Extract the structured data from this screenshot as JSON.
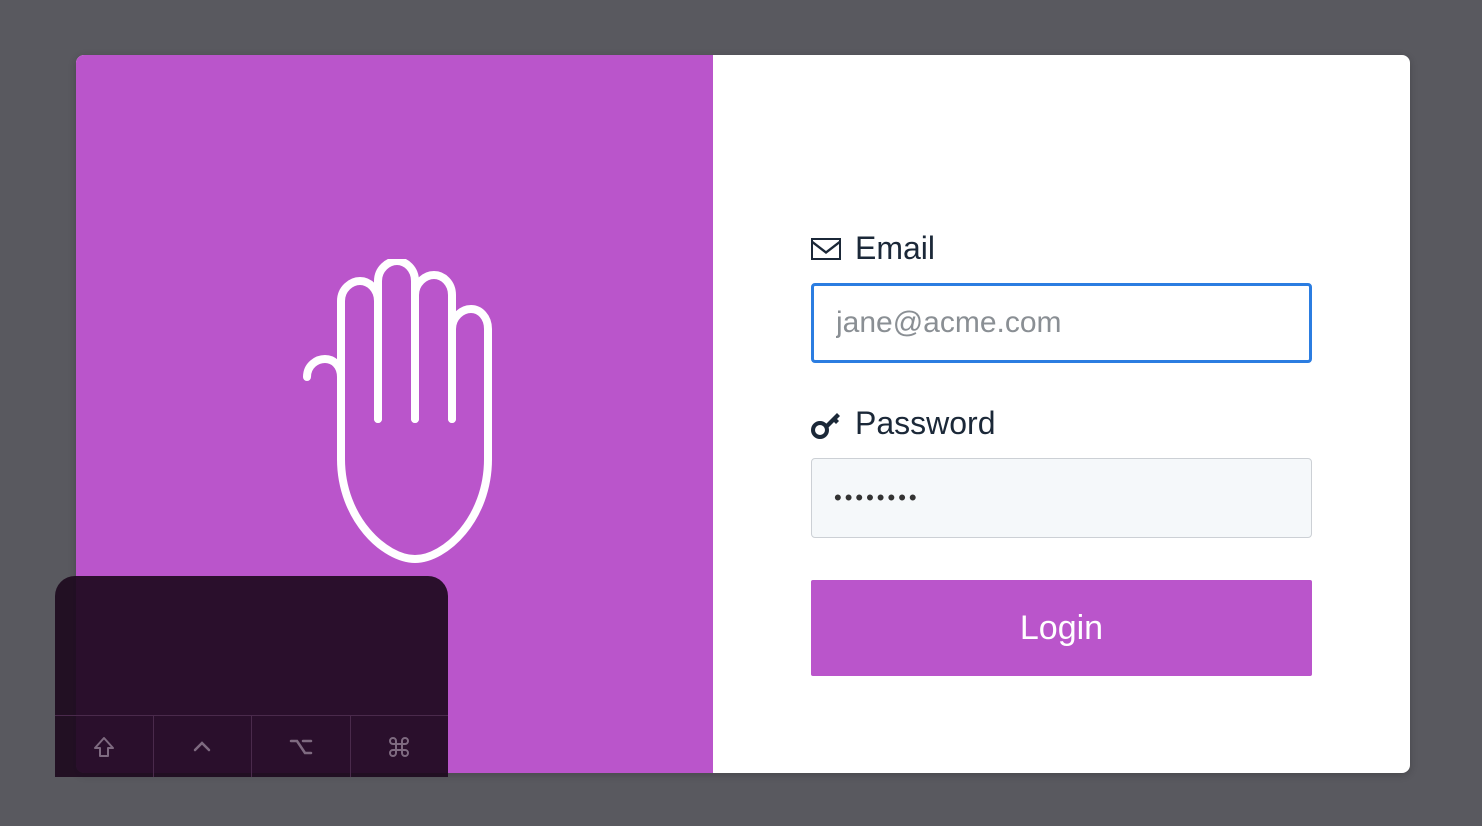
{
  "colors": {
    "accent": "#ba55cb",
    "text": "#1b2838",
    "focus": "#2b7de1",
    "background": "#59595f"
  },
  "login": {
    "email_label": "Email",
    "email_placeholder": "jane@acme.com",
    "email_value": "",
    "password_label": "Password",
    "password_value": "••••••••",
    "button_label": "Login"
  },
  "keyboard": {
    "keys": [
      "shift",
      "control",
      "option",
      "command"
    ]
  }
}
